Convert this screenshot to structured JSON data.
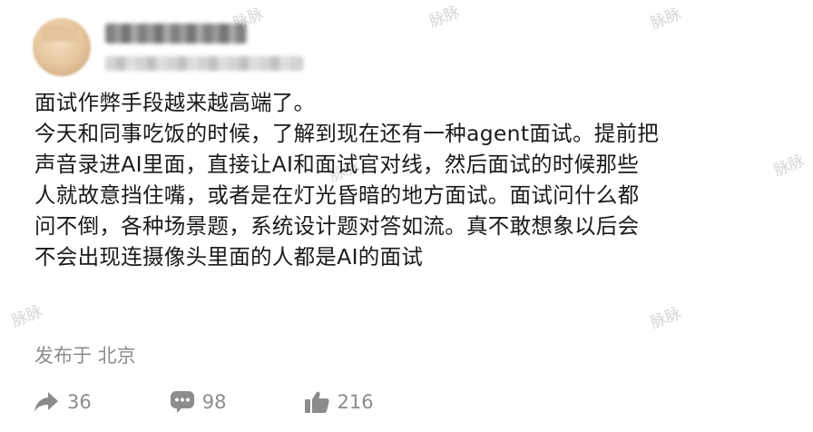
{
  "post": {
    "author": {
      "avatar_icon": "blurred-avatar",
      "name_hidden": true
    },
    "content_lines": [
      "面试作弊手段越来越高端了。",
      "今天和同事吃饭的时候，了解到现在还有一种agent面试。提前把",
      "声音录进AI里面，直接让AI和面试官对线，然后面试的时候那些",
      "人就故意挡住嘴，或者是在灯光昏暗的地方面试。面试问什么都",
      "问不倒，各种场景题，系统设计题对答如流。真不敢想象以后会",
      "不会出现连摄像头里面的人都是AI的面试"
    ],
    "location": "发布于 北京",
    "actions": {
      "share": {
        "icon": "share-icon",
        "count": "36"
      },
      "comment": {
        "icon": "comment-icon",
        "count": "98"
      },
      "like": {
        "icon": "thumbs-up-icon",
        "count": "216"
      }
    },
    "watermark": "脉脉",
    "colors": {
      "text": "#1a1a1a",
      "meta": "#8c8c8c",
      "watermark": "#d6d6d6"
    }
  }
}
